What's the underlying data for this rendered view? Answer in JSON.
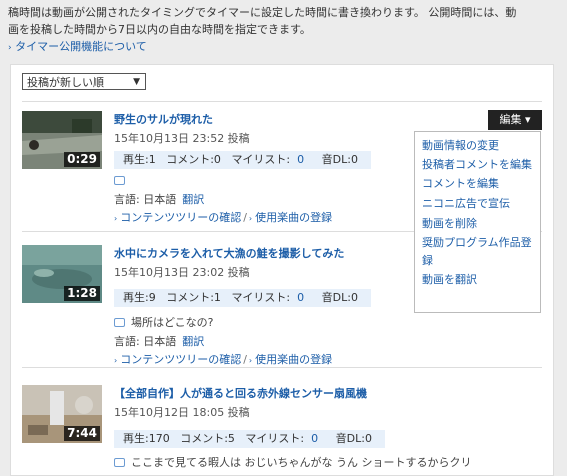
{
  "notice": {
    "line1": "稿時間は動画が公開されたタイミングでタイマーに設定した時間に書き換わります。 公開時間には、動",
    "line2": "画を投稿した時間から7日以内の自由な時間を指定できます。",
    "link": "タイマー公開機能について"
  },
  "sort": {
    "selected": "投稿が新しい順"
  },
  "edit": {
    "label": "編集",
    "menu": [
      "動画情報の変更",
      "投稿者コメントを編集",
      "コメントを編集",
      "ニコニ広告で宣伝",
      "動画を削除",
      "奨励プログラム作品登録",
      "動画を翻訳"
    ]
  },
  "videos": [
    {
      "title": "野生のサルが現れた",
      "date": "15年10月13日 23:52 投稿",
      "duration": "0:29",
      "views": "再生:1",
      "comments": "コメント:0",
      "mylist_label": "マイリスト:",
      "mylist": "0",
      "dl": "音DL:0",
      "comment": "",
      "lang": "言語: 日本語",
      "translate": "翻訳",
      "link1": "コンテンツツリーの確認",
      "link2": "使用楽曲の登録"
    },
    {
      "title": "水中にカメラを入れて大漁の鮭を撮影してみた",
      "date": "15年10月13日 23:02 投稿",
      "duration": "1:28",
      "views": "再生:9",
      "comments": "コメント:1",
      "mylist_label": "マイリスト:",
      "mylist": "0",
      "dl": "音DL:0",
      "comment": "場所はどこなの?",
      "lang": "言語: 日本語",
      "translate": "翻訳",
      "link1": "コンテンツツリーの確認",
      "link2": "使用楽曲の登録"
    },
    {
      "title": "【全部自作】人が通ると回る赤外線センサー扇風機",
      "date": "15年10月12日 18:05 投稿",
      "duration": "7:44",
      "views": "再生:170",
      "comments": "コメント:5",
      "mylist_label": "マイリスト:",
      "mylist": "0",
      "dl": "音DL:0",
      "comment": "ここまで見てる暇人は おじいちゃんがな うん ショートするからクリ"
    }
  ]
}
